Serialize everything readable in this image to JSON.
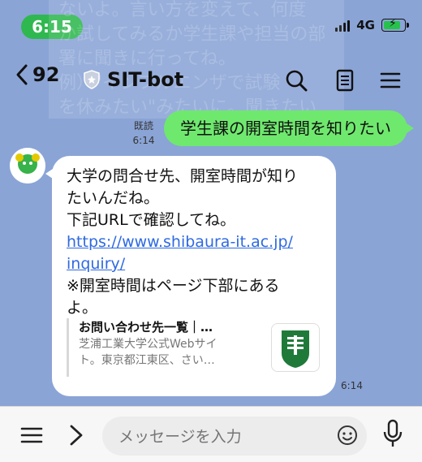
{
  "status": {
    "time": "6:15",
    "network": "4G"
  },
  "header": {
    "unread_count": "92",
    "title": "SIT-bot"
  },
  "background_ghost_text": [
    "ないよ。言い方を変えて、何度",
    "か試してみるか学生課や担当の部",
    "署に聞きに行ってね。",
    "例）\"インフルエンザで試験",
    "を休みたい\"みたいに。聞きたい"
  ],
  "messages": {
    "user": {
      "text": "学生課の開室時間を知りたい",
      "read_label": "既読",
      "time": "6:14"
    },
    "bot": {
      "line1": "大学の問合せ先、開室時間が知り",
      "line2": "たいんだね。",
      "line3": "下記URLで確認してね。",
      "link_line1": "https://www.shibaura-it.ac.jp/",
      "link_line2": "inquiry/",
      "line4": "※開室時間はページ下部にある",
      "line5": "よ。",
      "card": {
        "title": "お問い合わせ先一覧｜…",
        "desc1": "芝浦工業大学公式Webサイ",
        "desc2": "ト。東京都江東区、さい…"
      },
      "time": "6:14"
    }
  },
  "input": {
    "placeholder": "メッセージを入力"
  },
  "colors": {
    "background": "#8aa4d6",
    "user_bubble": "#6fe86e",
    "time_pill": "#2fb84f",
    "link": "#2f6ae0"
  }
}
